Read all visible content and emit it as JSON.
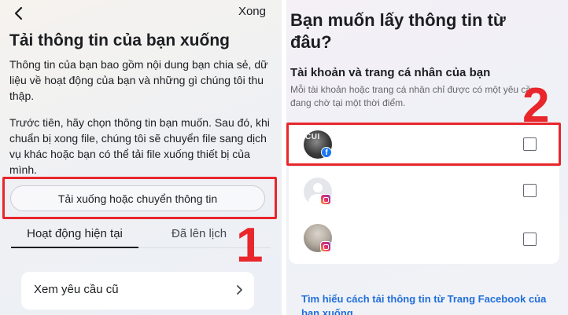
{
  "left": {
    "done_label": "Xong",
    "title": "Tải thông tin của bạn xuống",
    "desc1": "Thông tin của bạn bao gồm nội dung bạn chia sẻ, dữ liệu về hoạt động của bạn và những gì chúng tôi thu thập.",
    "desc2": "Trước tiên, hãy chọn thông tin bạn muốn. Sau đó, khi chuẩn bị xong file, chúng tôi sẽ chuyển file sang dịch vụ khác hoặc bạn có thể tải file xuống thiết bị của mình.",
    "download_button": "Tải xuống hoặc chuyển thông tin",
    "tabs": [
      {
        "label": "Hoạt động hiện tại"
      },
      {
        "label": "Đã lên lịch"
      }
    ],
    "old_requests": "Xem yêu cầu cũ",
    "step_number": "1"
  },
  "right": {
    "title": "Bạn muốn lấy thông tin từ đâu?",
    "subtitle": "Tài khoản và trang cá nhân của bạn",
    "note": "Mỗi tài khoản hoặc trang cá nhân chỉ được có một yêu cầu đang chờ tại một thời điểm.",
    "step_number": "2",
    "accounts": [
      {
        "avatar_text": "CUI",
        "platform": "facebook-icon"
      },
      {
        "avatar_text": "",
        "platform": "instagram-icon"
      },
      {
        "avatar_text": "",
        "platform": "instagram-icon"
      }
    ],
    "learn_link": "Tìm hiểu cách tải thông tin từ Trang Facebook của bạn xuống"
  },
  "colors": {
    "highlight_red": "#e8262b",
    "link_blue": "#216fdb",
    "facebook_blue": "#1877f2"
  }
}
